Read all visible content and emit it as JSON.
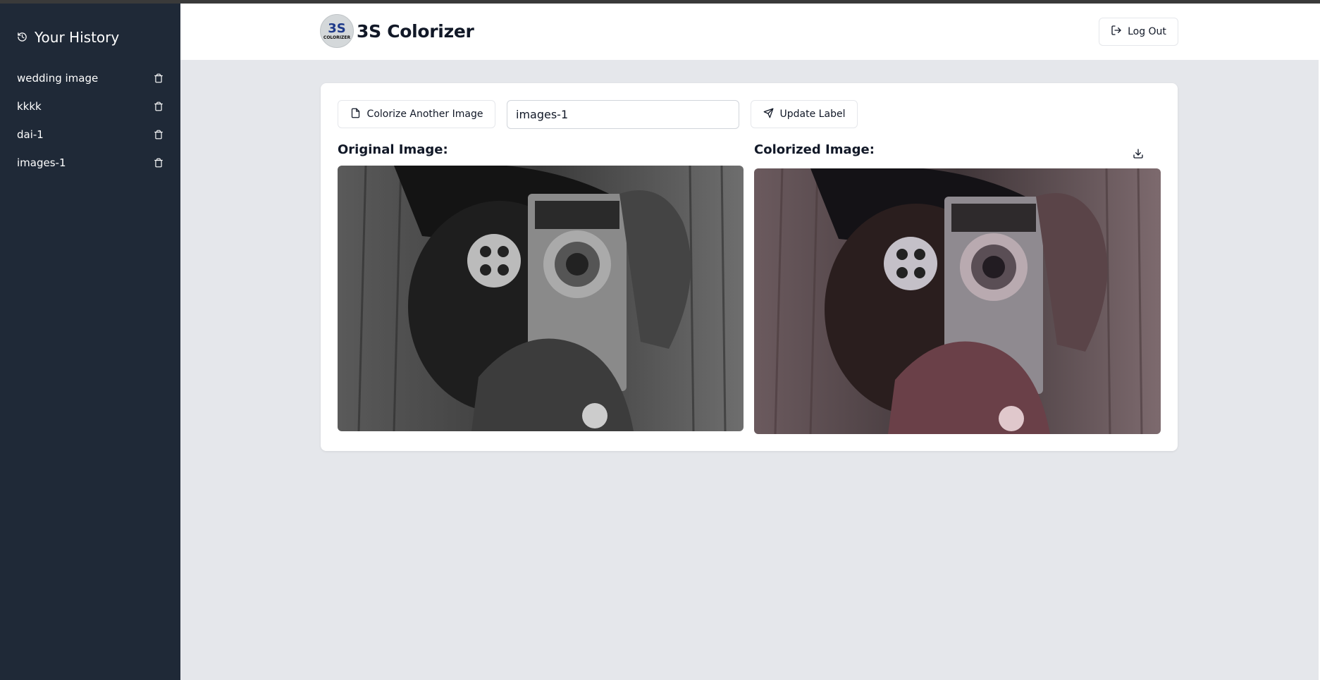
{
  "sidebar": {
    "title": "Your History",
    "items": [
      {
        "label": "wedding image"
      },
      {
        "label": "kkkk"
      },
      {
        "label": "dai-1"
      },
      {
        "label": "images-1"
      }
    ]
  },
  "header": {
    "app_title": "3S Colorizer",
    "logo": {
      "main": "3S",
      "sub": "COLORIZER"
    },
    "logout_label": "Log Out"
  },
  "main": {
    "colorize_label": "Colorize Another Image",
    "label_input_value": "images-1",
    "update_label": "Update Label",
    "original_title": "Original Image:",
    "colorized_title": "Colorized Image:"
  },
  "colors": {
    "sidebar_bg": "#1f2937",
    "page_bg": "#e5e7eb",
    "card_bg": "#ffffff",
    "text": "#111827"
  }
}
